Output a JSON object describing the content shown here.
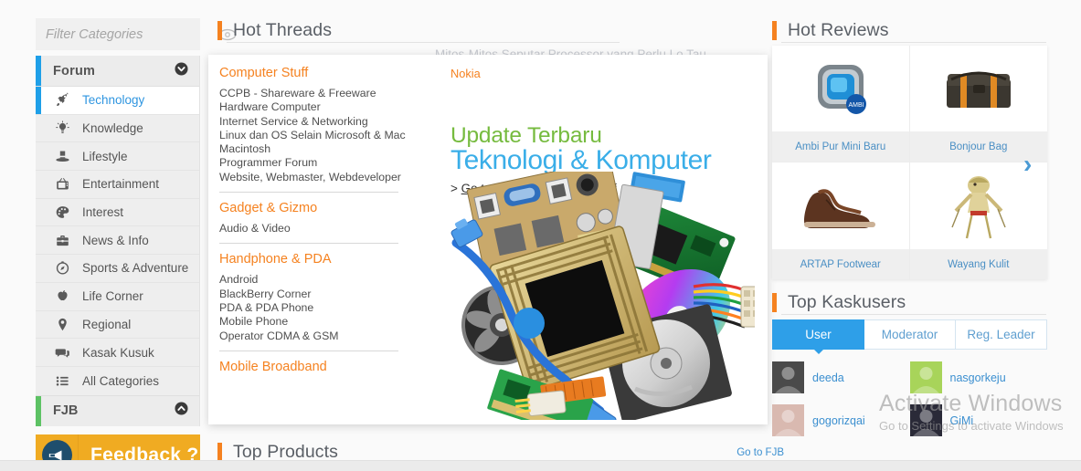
{
  "sidebar": {
    "filter": {
      "placeholder": "Filter Categories",
      "value": "",
      "eye_icon": "eye-icon"
    },
    "forum_header": {
      "label": "Forum",
      "chevron": "chevron-down-icon",
      "accent_color": "#1e9fe8"
    },
    "items": [
      {
        "label": "Technology",
        "icon": "rocket-icon",
        "active": true
      },
      {
        "label": "Knowledge",
        "icon": "lightbulb-icon",
        "active": false
      },
      {
        "label": "Lifestyle",
        "icon": "top-hat-icon",
        "active": false
      },
      {
        "label": "Entertainment",
        "icon": "tv-icon",
        "active": false
      },
      {
        "label": "Interest",
        "icon": "palette-icon",
        "active": false
      },
      {
        "label": "News & Info",
        "icon": "briefcase-icon",
        "active": false
      },
      {
        "label": "Sports & Adventure",
        "icon": "compass-icon",
        "active": false
      },
      {
        "label": "Life Corner",
        "icon": "apple-icon",
        "active": false
      },
      {
        "label": "Regional",
        "icon": "map-pin-icon",
        "active": false
      },
      {
        "label": "Kasak Kusuk",
        "icon": "chat-icon",
        "active": false
      },
      {
        "label": "All Categories",
        "icon": "list-icon",
        "active": false
      }
    ],
    "fjb": {
      "label": "FJB",
      "chevron": "chevron-up-icon",
      "accent_color": "#5dc264"
    },
    "feedback": {
      "label": "Feedback ?",
      "icon": "megaphone-icon",
      "bg_color": "#f0ab22"
    }
  },
  "main": {
    "hot_threads": {
      "title": "Hot Threads",
      "accent_color": "#f58220"
    },
    "first_thread": "Mitos-Mitos Seputar Processor yang Perlu Lo Tau...",
    "top_products": {
      "title": "Top Products",
      "link": "Go to FJB"
    }
  },
  "mega_menu": {
    "groups": [
      {
        "title": "Computer Stuff",
        "items": [
          "CCPB - Shareware & Freeware",
          "Hardware Computer",
          "Internet Service & Networking",
          "Linux dan OS Selain Microsoft & Mac",
          "Macintosh",
          "Programmer Forum",
          "Website, Webmaster, Webdeveloper"
        ]
      },
      {
        "title": "Gadget & Gizmo",
        "items": [
          "Audio & Video"
        ]
      },
      {
        "title": "Handphone & PDA",
        "items": [
          "Android",
          "BlackBerry Corner",
          "PDA & PDA Phone",
          "Mobile Phone",
          "Operator CDMA & GSM"
        ]
      },
      {
        "title": "Mobile Broadband",
        "items": []
      }
    ],
    "side_link": "Nokia",
    "promo": {
      "line1": "Update Terbaru",
      "line2": "Teknologi & Komputer",
      "cta_prefix": "> ",
      "cta": "Go to Forum Computer Stuff",
      "line1_color": "#76bb3f",
      "line2_color": "#3aaee8"
    }
  },
  "right": {
    "hot_reviews": {
      "title": "Hot Reviews",
      "accent_color": "#f58220",
      "next_arrow": "chevron-right-icon"
    },
    "reviews": [
      {
        "label": "Ambi Pur Mini Baru",
        "image": "air-freshener-image"
      },
      {
        "label": "Bonjour Bag",
        "image": "messenger-bag-image"
      },
      {
        "label": "ARTAP Footwear",
        "image": "brown-boot-image"
      },
      {
        "label": "Wayang Kulit",
        "image": "puppet-image"
      }
    ],
    "top_kaskusers": {
      "title": "Top Kaskusers",
      "accent_color": "#f58220"
    },
    "tabs": [
      {
        "label": "User",
        "active": true
      },
      {
        "label": "Moderator",
        "active": false
      },
      {
        "label": "Reg. Leader",
        "active": false
      }
    ],
    "users": [
      {
        "name": "deeda",
        "avatar_color": "#4a4a4a"
      },
      {
        "name": "nasgorkeju",
        "avatar_color": "#a8d45a"
      },
      {
        "name": "gogorizqai",
        "avatar_color": "#d9b9b0"
      },
      {
        "name": "GiMi",
        "avatar_color": "#2a2a38"
      }
    ]
  },
  "watermark": {
    "line1": "Activate Windows",
    "line2": "Go to Settings to activate Windows"
  }
}
